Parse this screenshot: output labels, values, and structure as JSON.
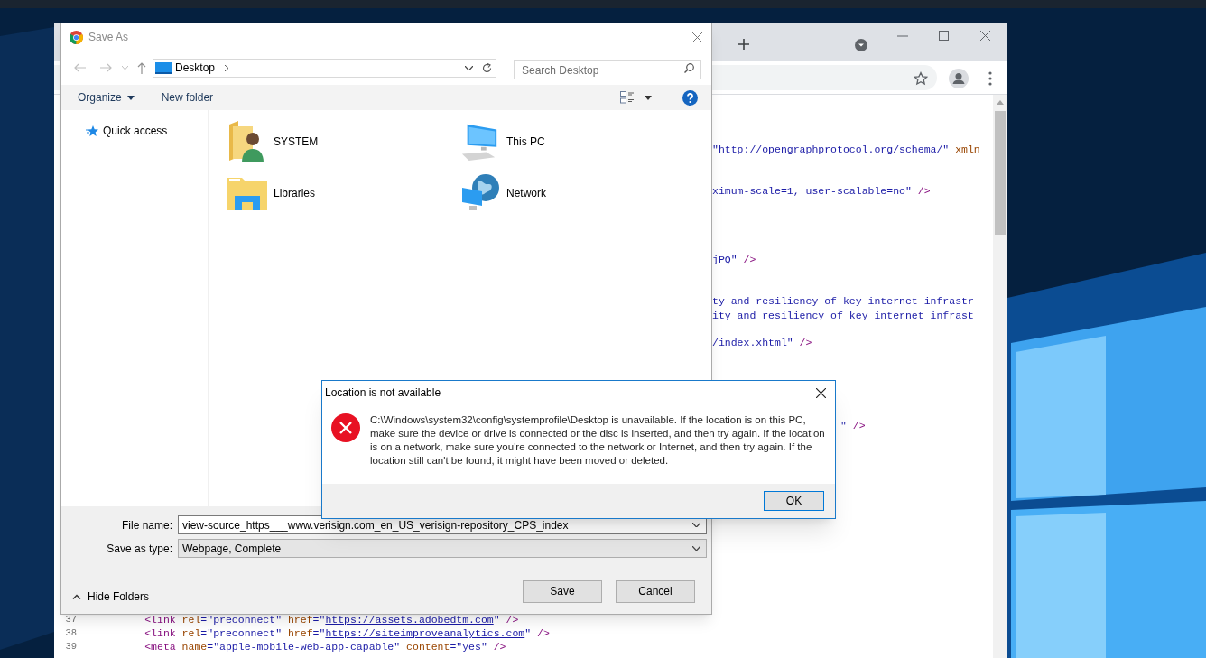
{
  "browser": {
    "code_fragments": [
      {
        "tokens": [
          {
            "text": "\"http://opengraphprotocol.org/schema/\"",
            "kind": "value"
          },
          {
            "text": " xmln",
            "kind": "attr"
          }
        ]
      },
      {
        "tokens": [
          {
            "text": "ximum-scale=1, user-scalable=no\"",
            "kind": "value"
          },
          {
            "text": " />",
            "kind": "tag"
          }
        ]
      },
      {
        "tokens": [
          {
            "text": "jPQ\"",
            "kind": "value"
          },
          {
            "text": " />",
            "kind": "tag"
          }
        ]
      },
      {
        "tokens": [
          {
            "text": "ty and resiliency of key internet infrastr",
            "kind": "value"
          }
        ]
      },
      {
        "tokens": [
          {
            "text": "ity and resiliency of key internet infrast",
            "kind": "value"
          }
        ]
      },
      {
        "tokens": [
          {
            "text": "/index.xhtml\"",
            "kind": "value"
          },
          {
            "text": " />",
            "kind": "tag"
          }
        ]
      },
      {
        "tokens": [
          {
            "text": "\"",
            "kind": "value"
          },
          {
            "text": " />",
            "kind": "tag"
          }
        ]
      }
    ],
    "code_lines": [
      {
        "number": "37",
        "tokens": [
          {
            "text": "        <link",
            "kind": "tag"
          },
          {
            "text": " rel",
            "kind": "attr"
          },
          {
            "text": "=\"preconnect\"",
            "kind": "value"
          },
          {
            "text": " href",
            "kind": "attr"
          },
          {
            "text": "=\"",
            "kind": "value"
          },
          {
            "text": "https://assets.adobedtm.com",
            "kind": "link"
          },
          {
            "text": "\"",
            "kind": "value"
          },
          {
            "text": " />",
            "kind": "tag"
          }
        ]
      },
      {
        "number": "38",
        "tokens": [
          {
            "text": "        <link",
            "kind": "tag"
          },
          {
            "text": " rel",
            "kind": "attr"
          },
          {
            "text": "=\"preconnect\"",
            "kind": "value"
          },
          {
            "text": " href",
            "kind": "attr"
          },
          {
            "text": "=\"",
            "kind": "value"
          },
          {
            "text": "https://siteimproveanalytics.com",
            "kind": "link"
          },
          {
            "text": "\"",
            "kind": "value"
          },
          {
            "text": " />",
            "kind": "tag"
          }
        ]
      },
      {
        "number": "39",
        "tokens": [
          {
            "text": "        <meta",
            "kind": "tag"
          },
          {
            "text": " name",
            "kind": "attr"
          },
          {
            "text": "=\"apple-mobile-web-app-capable\"",
            "kind": "value"
          },
          {
            "text": " content",
            "kind": "attr"
          },
          {
            "text": "=\"yes\"",
            "kind": "value"
          },
          {
            "text": " />",
            "kind": "tag"
          }
        ]
      }
    ]
  },
  "save_dialog": {
    "title": "Save As",
    "address": "Desktop",
    "search": {
      "placeholder": "Search Desktop"
    },
    "toolbar": [
      {
        "label": "Organize",
        "kind": "menu"
      },
      {
        "label": "New folder",
        "kind": "button"
      }
    ],
    "navigation": [
      {
        "label": "Quick access"
      }
    ],
    "items": [
      {
        "label": "SYSTEM",
        "kind": "user-folder"
      },
      {
        "label": "This PC",
        "kind": "computer"
      },
      {
        "label": "Libraries",
        "kind": "libraries"
      },
      {
        "label": "Network",
        "kind": "network"
      }
    ],
    "file_name": {
      "label": "File name:",
      "value": "view-source_https___www.verisign.com_en_US_verisign-repository_CPS_index"
    },
    "save_as_type": {
      "label": "Save as type:",
      "value": "Webpage, Complete"
    },
    "hide_folders": "Hide Folders",
    "buttons": [
      "Save",
      "Cancel"
    ]
  },
  "error_dialog": {
    "title": "Location is not available",
    "message": "C:\\Windows\\system32\\config\\systemprofile\\Desktop is unavailable. If the location is on this PC, make sure the device or drive is connected or the disc is inserted, and then try again. If the location is on a network, make sure you're connected to the network or Internet, and then try again. If the location still can't be found, it might have been moved or deleted.",
    "buttons": [
      "OK"
    ]
  }
}
